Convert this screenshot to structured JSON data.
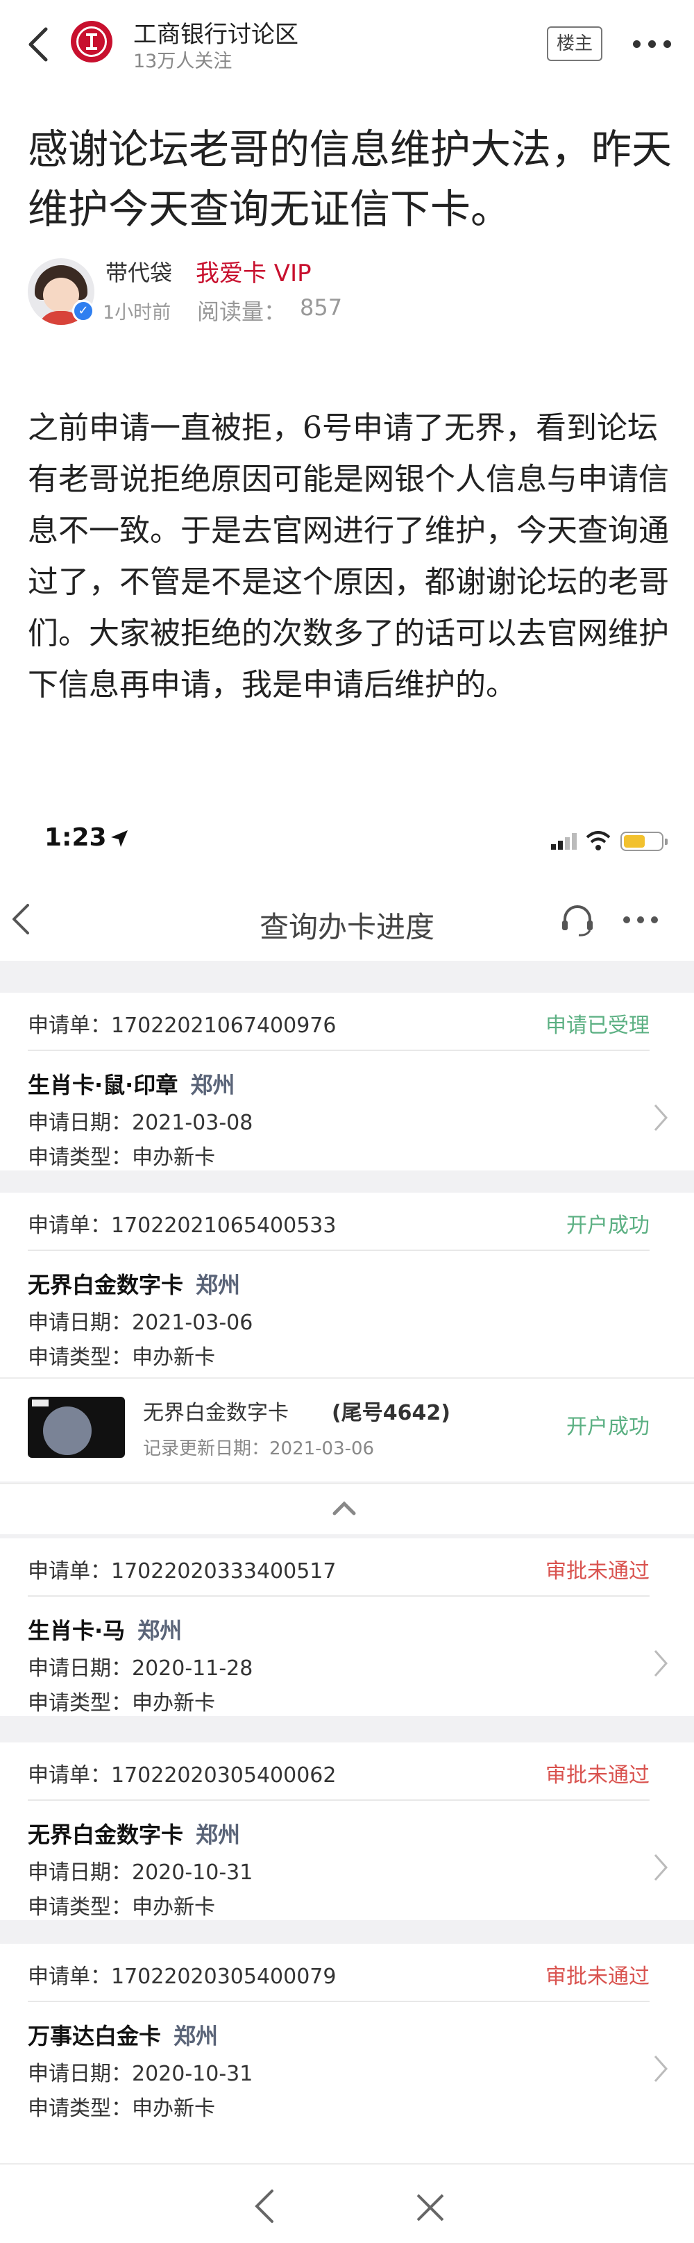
{
  "forum": {
    "title": "工商银行讨论区",
    "followers": "13万人关注",
    "op_button": "楼主"
  },
  "post": {
    "title": "感谢论坛老哥的信息维护大法，昨天维护今天查询无证信下卡。",
    "author": "带代袋",
    "author_tag": "我爱卡 VIP",
    "time": "1小时前",
    "read_label": "阅读量：",
    "read_count": "857",
    "body": "之前申请一直被拒，6号申请了无界，看到论坛有老哥说拒绝原因可能是网银个人信息与申请信息不一致。于是去官网进行了维护，今天查询通过了，不管是不是这个原因，都谢谢论坛的老哥们。大家被拒绝的次数多了的话可以去官网维护下信息再申请，我是申请后维护的。"
  },
  "status_bar": {
    "time": "1:23"
  },
  "app": {
    "title": "查询办卡进度",
    "applications": [
      {
        "no": "申请单：17022021067400976",
        "status": "申请已受理",
        "status_color": "#5cb083",
        "name": "生肖卡·鼠·印章",
        "city": "郑州",
        "date": "申请日期：2021-03-08",
        "type": "申请类型：申办新卡"
      },
      {
        "no": "申请单：17022021065400533",
        "status": "开户成功",
        "status_color": "#5cb083",
        "name": "无界白金数字卡",
        "city": "郑州",
        "date": "申请日期：2021-03-06",
        "type": "申请类型：申办新卡"
      },
      {
        "no": "申请单：17022020333400517",
        "status": "审批未通过",
        "status_color": "#d9534f",
        "name": "生肖卡·马",
        "city": "郑州",
        "date": "申请日期：2020-11-28",
        "type": "申请类型：申办新卡"
      },
      {
        "no": "申请单：17022020305400062",
        "status": "审批未通过",
        "status_color": "#d9534f",
        "name": "无界白金数字卡",
        "city": "郑州",
        "date": "申请日期：2020-10-31",
        "type": "申请类型：申办新卡"
      },
      {
        "no": "申请单：17022020305400079",
        "status": "审批未通过",
        "status_color": "#d9534f",
        "name": "万事达白金卡",
        "city": "郑州",
        "date": "申请日期：2020-10-31",
        "type": "申请类型：申办新卡"
      }
    ],
    "issued_card": {
      "title": "无界白金数字卡 ",
      "tail": "(尾号4642)",
      "updated": "记录更新日期：2021-03-06",
      "status": "开户成功"
    }
  },
  "icons": {
    "bank_logo": "icbc-logo-icon",
    "back": "chevron-left-icon",
    "more": "more-dots-icon",
    "location": "location-arrow-icon",
    "headset": "headset-icon",
    "row_chevron": "chevron-right-icon",
    "collapse": "chevron-up-icon",
    "close": "close-icon"
  }
}
